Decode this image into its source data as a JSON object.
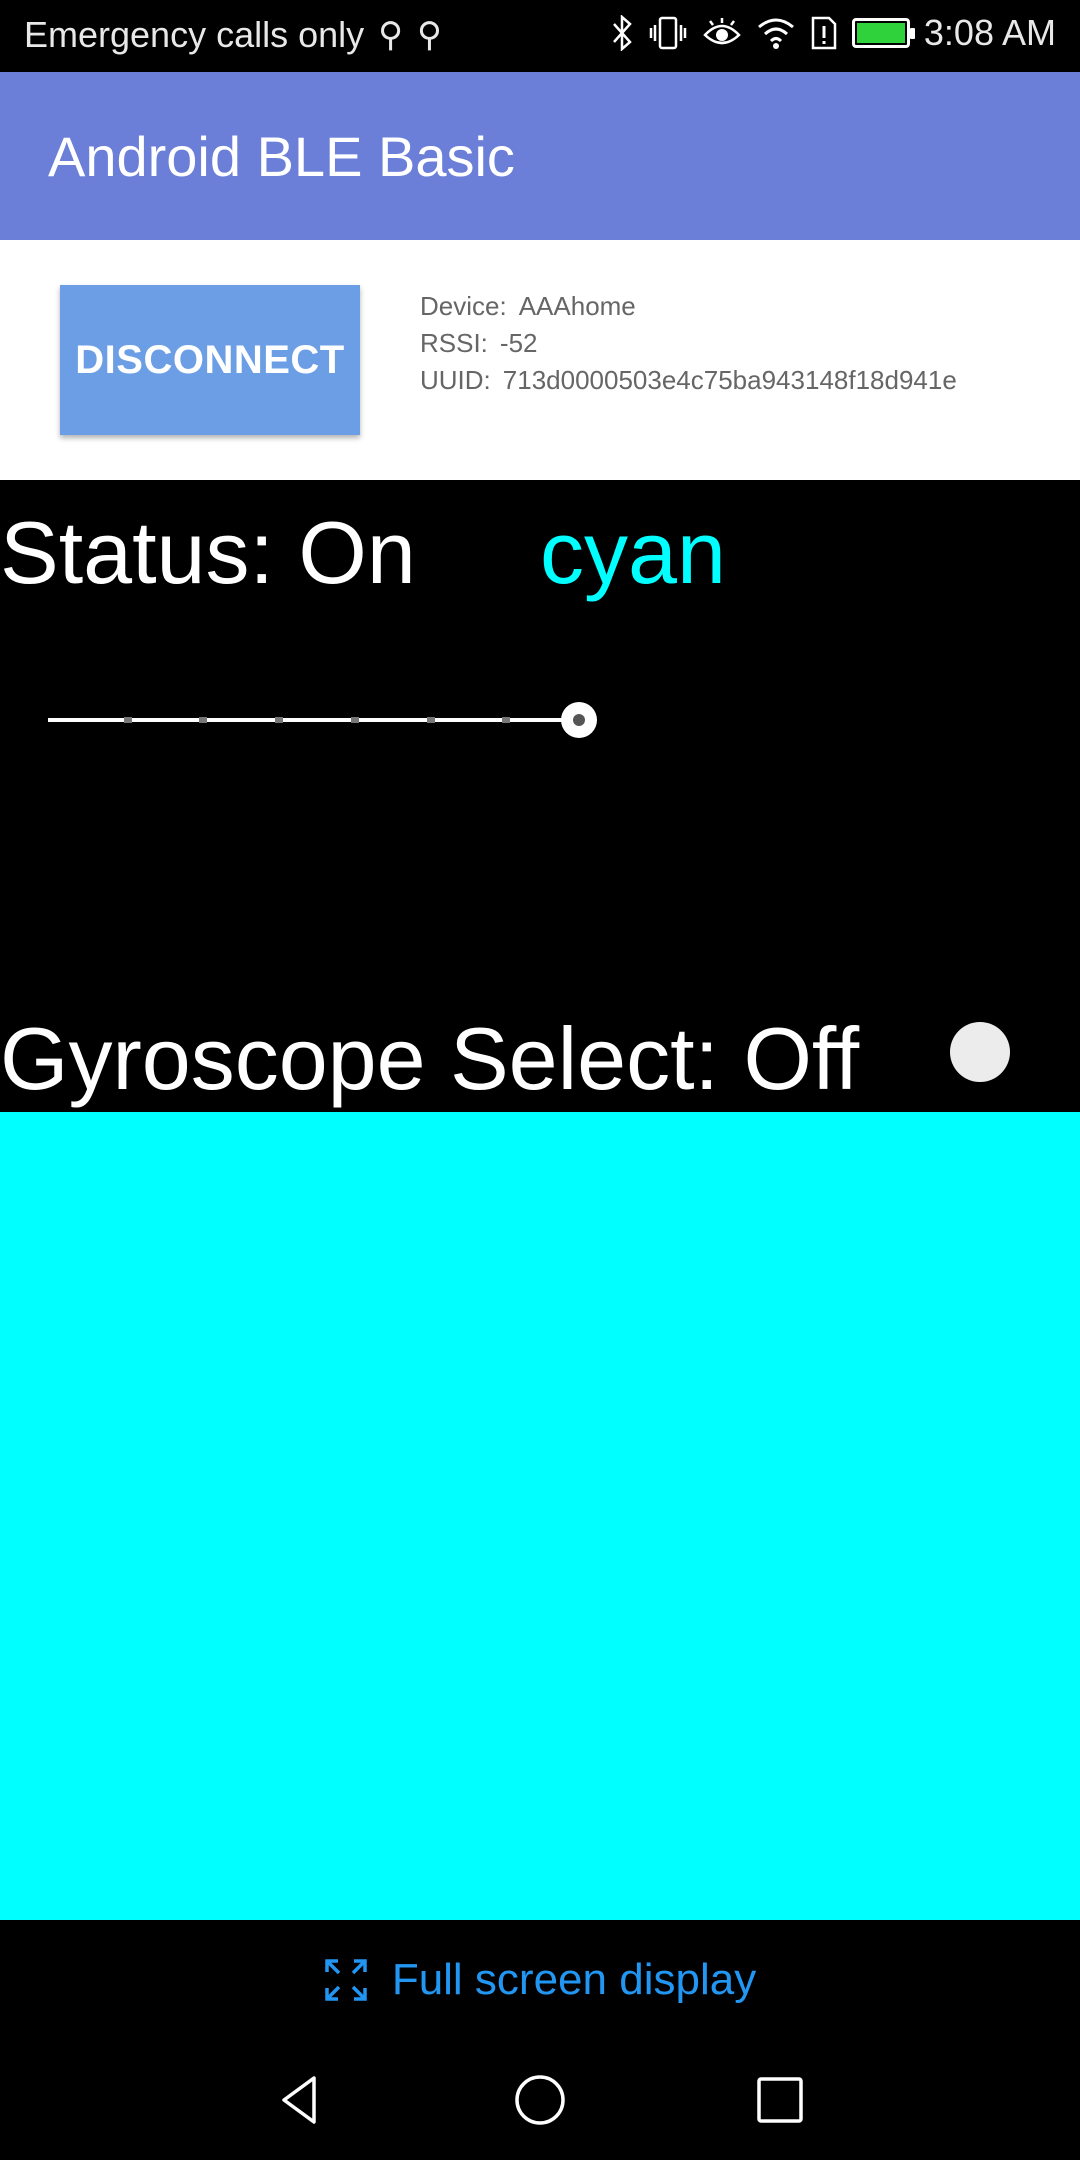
{
  "status_bar": {
    "carrier": "Emergency calls only",
    "time": "3:08 AM",
    "icons": [
      "usb-icon",
      "usb-icon",
      "bluetooth-icon",
      "vibrate-icon",
      "eye-icon",
      "wifi-icon",
      "sim-alert-icon",
      "battery-icon"
    ],
    "battery_color": "#2fd23a"
  },
  "app_bar": {
    "title": "Android BLE Basic",
    "color": "#6b7ed8"
  },
  "device": {
    "button_label": "DISCONNECT",
    "device_label": "Device:",
    "device_value": "AAAhome",
    "rssi_label": "RSSI:",
    "rssi_value": "-52",
    "uuid_label": "UUID:",
    "uuid_value": "713d0000503e4c75ba943148f18d941e"
  },
  "main": {
    "status_text": "Status: On",
    "color_name": "cyan",
    "color_hex": "#00ffff",
    "slider_level": 1.0,
    "slider_steps": 7,
    "gyro_text": "Gyroscope Select: Off",
    "gyro_on": false
  },
  "fullscreen": {
    "label": "Full screen display",
    "icon": "expand-icon"
  },
  "nav": {
    "buttons": [
      "back-icon",
      "home-icon",
      "recents-icon"
    ]
  }
}
